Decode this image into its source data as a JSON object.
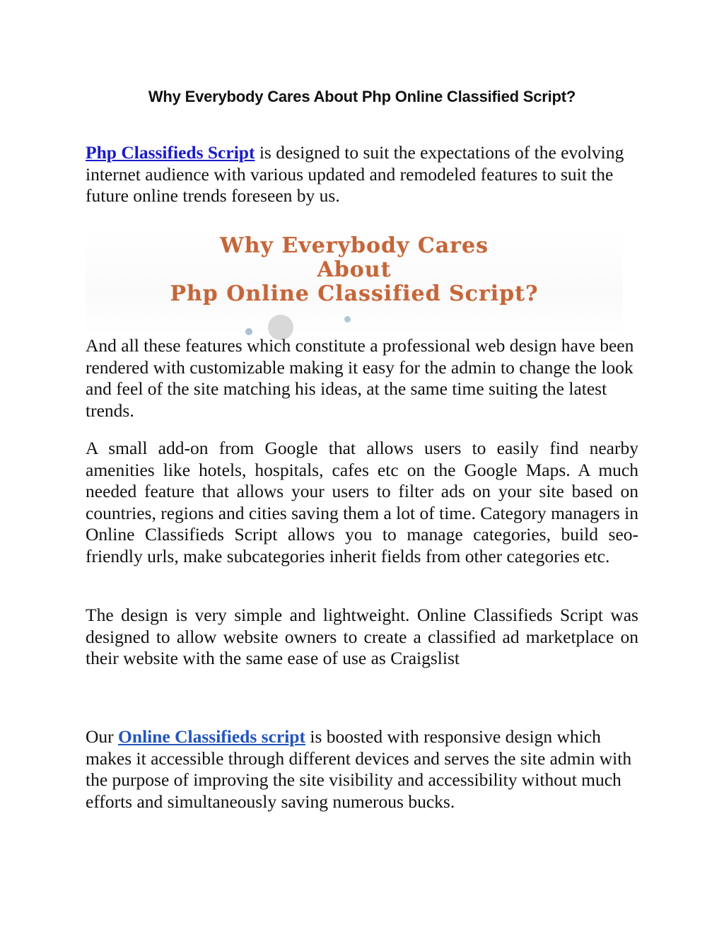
{
  "document": {
    "title": "Why Everybody Cares About Php Online Classified Script?",
    "colors": {
      "link_primary": "#1a1acc",
      "link_secondary": "#2255bb",
      "banner_text": "#c4663a"
    },
    "paragraph1": {
      "link_text": "Php Classifieds Script",
      "text": " is designed to suit the expectations of the evolving internet audience with various updated and remodeled features to suit the future online trends foreseen by us."
    },
    "banner": {
      "line1": "Why Everybody Cares",
      "line2": "About",
      "line3": "Php Online Classified Script?"
    },
    "paragraph2": "And all these features which constitute a professional web design have been rendered with customizable making it easy for the admin to change the look and feel of the site matching his ideas, at the same time suiting the latest trends.",
    "paragraph3": "A small add-on from Google that allows users to easily find nearby amenities like hotels, hospitals, cafes etc on the Google Maps. A much needed feature that allows your users to filter ads on your site based on countries, regions and cities saving them a lot of time. Category managers in Online Classifieds Script allows you to manage categories, build seo-friendly urls, make subcategories inherit fields from other categories etc.",
    "paragraph4": "The design is very simple and lightweight. Online Classifieds Script was designed to allow website owners to create a classified ad marketplace on their website with the same ease of use as Craigslist",
    "paragraph5": {
      "prefix": "Our ",
      "link_text": "Online Classifieds script",
      "text": " is boosted with responsive design which makes it accessible through different devices and serves the site admin with the purpose of improving the site visibility and accessibility without much efforts and simultaneously saving numerous bucks."
    }
  }
}
